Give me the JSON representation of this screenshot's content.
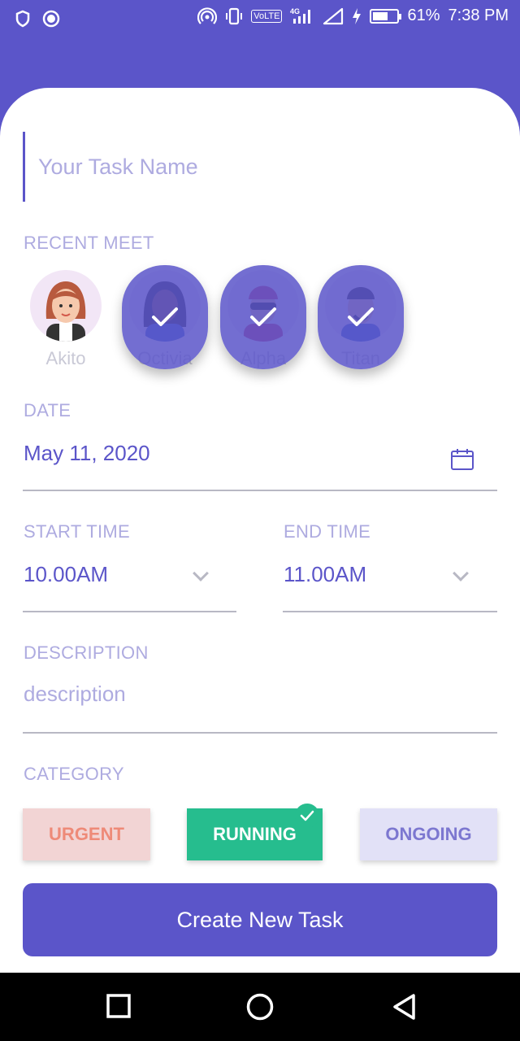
{
  "status_bar": {
    "battery_percent": "61%",
    "time": "7:38 PM",
    "network": "4G",
    "volte": "VoLTE",
    "battery_level": 0.61,
    "icons": [
      "shield-icon",
      "record-icon",
      "hotspot-icon",
      "vibrate-icon",
      "volte-icon",
      "signal-icon",
      "wifi-signal-icon",
      "charging-icon",
      "battery-icon"
    ]
  },
  "task": {
    "name_placeholder": "Your Task Name"
  },
  "recent_meet": {
    "label": "RECENT MEET",
    "people": [
      {
        "name": "Akito",
        "selected": false
      },
      {
        "name": "Octivia",
        "selected": true
      },
      {
        "name": "Alpha",
        "selected": true
      },
      {
        "name": "Titan",
        "selected": true
      }
    ]
  },
  "date": {
    "label": "DATE",
    "value": "May 11, 2020"
  },
  "start_time": {
    "label": "START TIME",
    "value": "10.00AM"
  },
  "end_time": {
    "label": "END TIME",
    "value": "11.00AM"
  },
  "description": {
    "label": "DESCRIPTION",
    "placeholder": "description"
  },
  "category": {
    "label": "CATEGORY",
    "options": [
      {
        "label": "URGENT",
        "selected": false
      },
      {
        "label": "RUNNING",
        "selected": true
      },
      {
        "label": "ONGOING",
        "selected": false
      }
    ]
  },
  "create_button": {
    "label": "Create New Task"
  },
  "colors": {
    "primary": "#5b55c9",
    "muted_label": "#aeabe0",
    "running": "#26bd8e",
    "urgent_bg": "#f2d4d4",
    "urgent_text": "#ee8a78",
    "ongoing_bg": "#e2e1f7"
  }
}
